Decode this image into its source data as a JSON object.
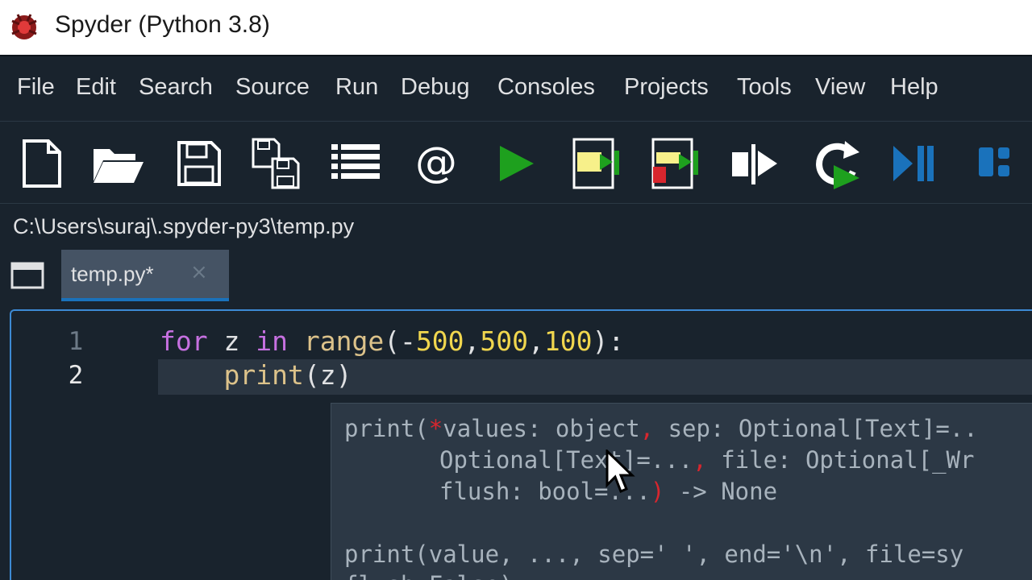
{
  "window": {
    "title": "Spyder (Python 3.8)"
  },
  "menu": [
    "File",
    "Edit",
    "Search",
    "Source",
    "Run",
    "Debug",
    "Consoles",
    "Projects",
    "Tools",
    "View",
    "Help"
  ],
  "toolbar": {
    "icons": [
      "new-file-icon",
      "open-file-icon",
      "save-icon",
      "save-all-icon",
      "outline-icon",
      "at-sign-icon",
      "run-icon",
      "run-cell-icon",
      "run-cell-advance-icon",
      "run-selection-icon",
      "rerun-icon",
      "debug-icon",
      "maximize-pane-icon"
    ],
    "at_symbol": "@"
  },
  "path": "C:\\Users\\suraj\\.spyder-py3\\temp.py",
  "tab": {
    "label": "temp.py*",
    "close": "×"
  },
  "editor": {
    "line_numbers": [
      "1",
      "2"
    ],
    "line1": {
      "kw1": "for",
      "var": " z ",
      "kw2": "in",
      "sp": " ",
      "fn": "range",
      "open": "(-",
      "n1": "500",
      "c1": ",",
      "n2": "500",
      "c2": ",",
      "n3": "100",
      "close": "):"
    },
    "line2": {
      "indent": "    ",
      "fn": "print",
      "args": "(z)"
    }
  },
  "calltip": {
    "l1a": "print(",
    "l1star": "*",
    "l1b": "values: object",
    "l1comma": ",",
    "l1c": " sep: Optional[Text]=..",
    "l2a": "Optional[Text]=...",
    "l2comma": ",",
    "l2b": " file: Optional[_Wr",
    "l3a": "flush: bool=...",
    "l3paren": ")",
    "l3b": " -> None",
    "l4": "print(value, ..., sep=' ', end='\\n', file=sy",
    "l5": "flush=False)"
  },
  "colors": {
    "accent": "#1a72bb",
    "run_green": "#1ea01e",
    "background": "#19232d"
  }
}
